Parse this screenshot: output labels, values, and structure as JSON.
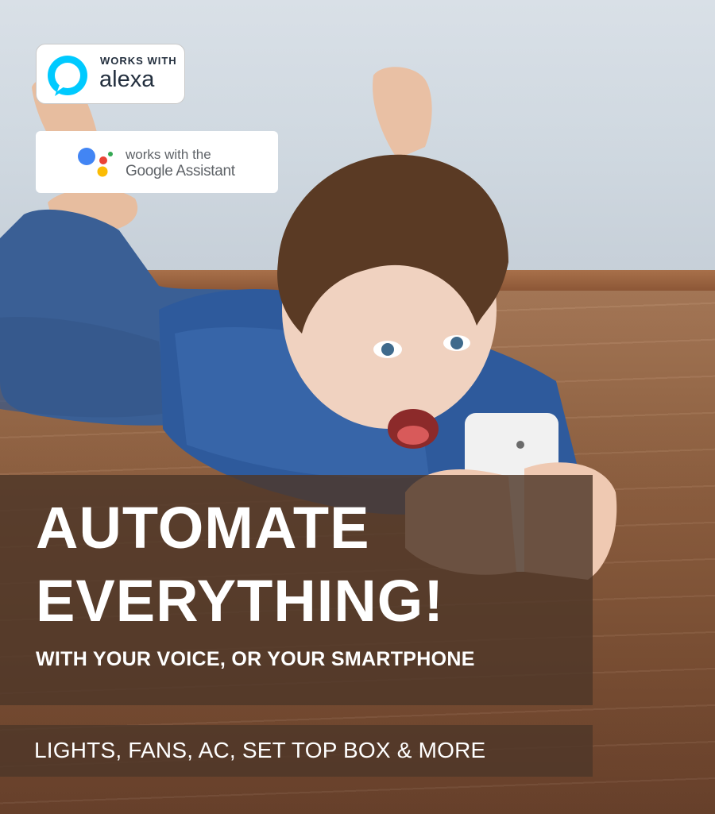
{
  "alexa_badge": {
    "line1": "WORKS WITH",
    "line2": "alexa",
    "icon": "alexa-ring-icon",
    "color": "#00caff"
  },
  "google_badge": {
    "line1": "works with the",
    "line2": "Google Assistant",
    "icon": "google-assistant-dots-icon",
    "dot_colors": [
      "#4285f4",
      "#ea4335",
      "#fbbc05",
      "#34a853"
    ]
  },
  "headline": {
    "line1": "AUTOMATE",
    "line2": "EVERYTHING!",
    "subline": "WITH YOUR VOICE, OR YOUR SMARTPHONE"
  },
  "features": {
    "text": "LIGHTS, FANS, AC, SET TOP BOX & MORE"
  },
  "panel_color": "#4e3728"
}
